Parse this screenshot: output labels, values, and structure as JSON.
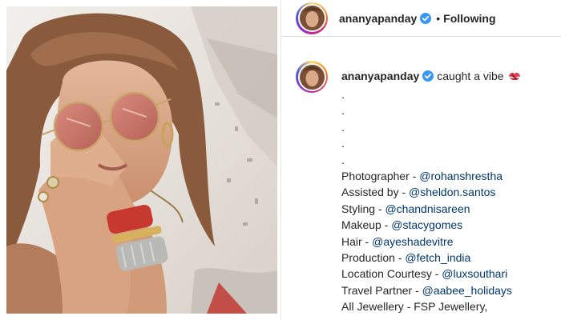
{
  "post": {
    "username": "ananyapanday",
    "follow_status": "Following",
    "header_separator": "•",
    "caption": "caught a vibe",
    "caption_emoji": "lipstick-kiss-icon",
    "dot_lines": [
      ".",
      ".",
      ".",
      ".",
      "."
    ],
    "credits": [
      {
        "label": "Photographer - ",
        "mention": "@rohanshrestha"
      },
      {
        "label": "Assisted by - ",
        "mention": "@sheldon.santos"
      },
      {
        "label": "Styling - ",
        "mention": "@chandnisareen"
      },
      {
        "label": "Makeup - ",
        "mention": "@stacygomes"
      },
      {
        "label": "Hair - ",
        "mention": "@ayeshadevitre"
      },
      {
        "label": "Production - ",
        "mention": "@fetch_india"
      },
      {
        "label": "Location Courtesy - ",
        "mention": "@luxsouthari"
      },
      {
        "label": "Travel Partner - ",
        "mention": "@aabee_holidays"
      },
      {
        "label": "All Jewellery - FSP Jewellery,",
        "mention": ""
      }
    ]
  },
  "colors": {
    "text": "#262626",
    "mention": "#00376b",
    "verified": "#3897f0",
    "divider": "#dbdbdb"
  }
}
